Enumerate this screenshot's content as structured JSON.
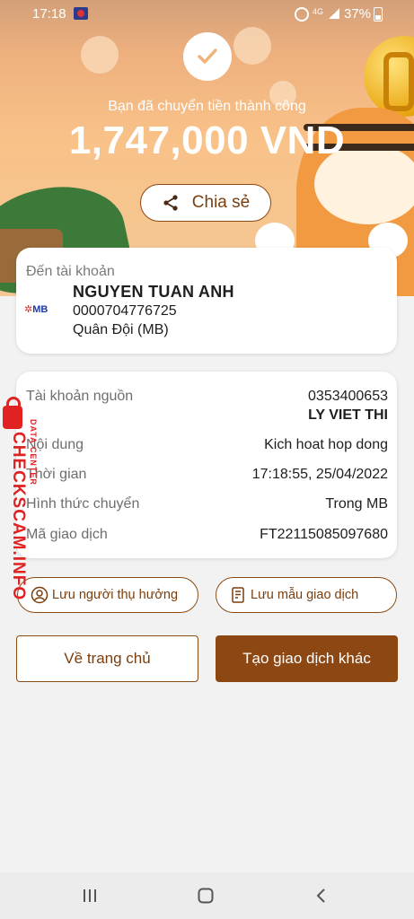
{
  "status_bar": {
    "time": "17:18",
    "network": "4G",
    "battery": "37%"
  },
  "hero": {
    "success_message": "Bạn đã chuyển tiền thành công",
    "amount": "1,747,000 VND",
    "share_label": "Chia sẻ"
  },
  "destination": {
    "label": "Đến tài khoản",
    "bank_logo": "MB",
    "name": "NGUYEN TUAN ANH",
    "account_number": "0000704776725",
    "bank_name": "Quân Đội (MB)"
  },
  "details": {
    "source_label": "Tài khoản nguồn",
    "source_account": "0353400653",
    "source_name": "LY VIET THI",
    "content_label": "Nội dung",
    "content_value": "Kich hoat hop dong",
    "time_label": "Thời gian",
    "time_value": "17:18:55, 25/04/2022",
    "method_label": "Hình thức chuyển",
    "method_value": "Trong MB",
    "code_label": "Mã giao dịch",
    "code_value": "FT22115085097680"
  },
  "actions": {
    "save_recipient": "Lưu người thụ hưởng",
    "save_template": "Lưu mẫu giao dịch",
    "home": "Về trang chủ",
    "new_transaction": "Tạo giao dịch khác"
  },
  "watermark": {
    "site": "CHECKSCAM.INFO",
    "sub": "DATA CENTER"
  },
  "colors": {
    "accent": "#8c4712",
    "hero_bg": "#f8c188"
  }
}
